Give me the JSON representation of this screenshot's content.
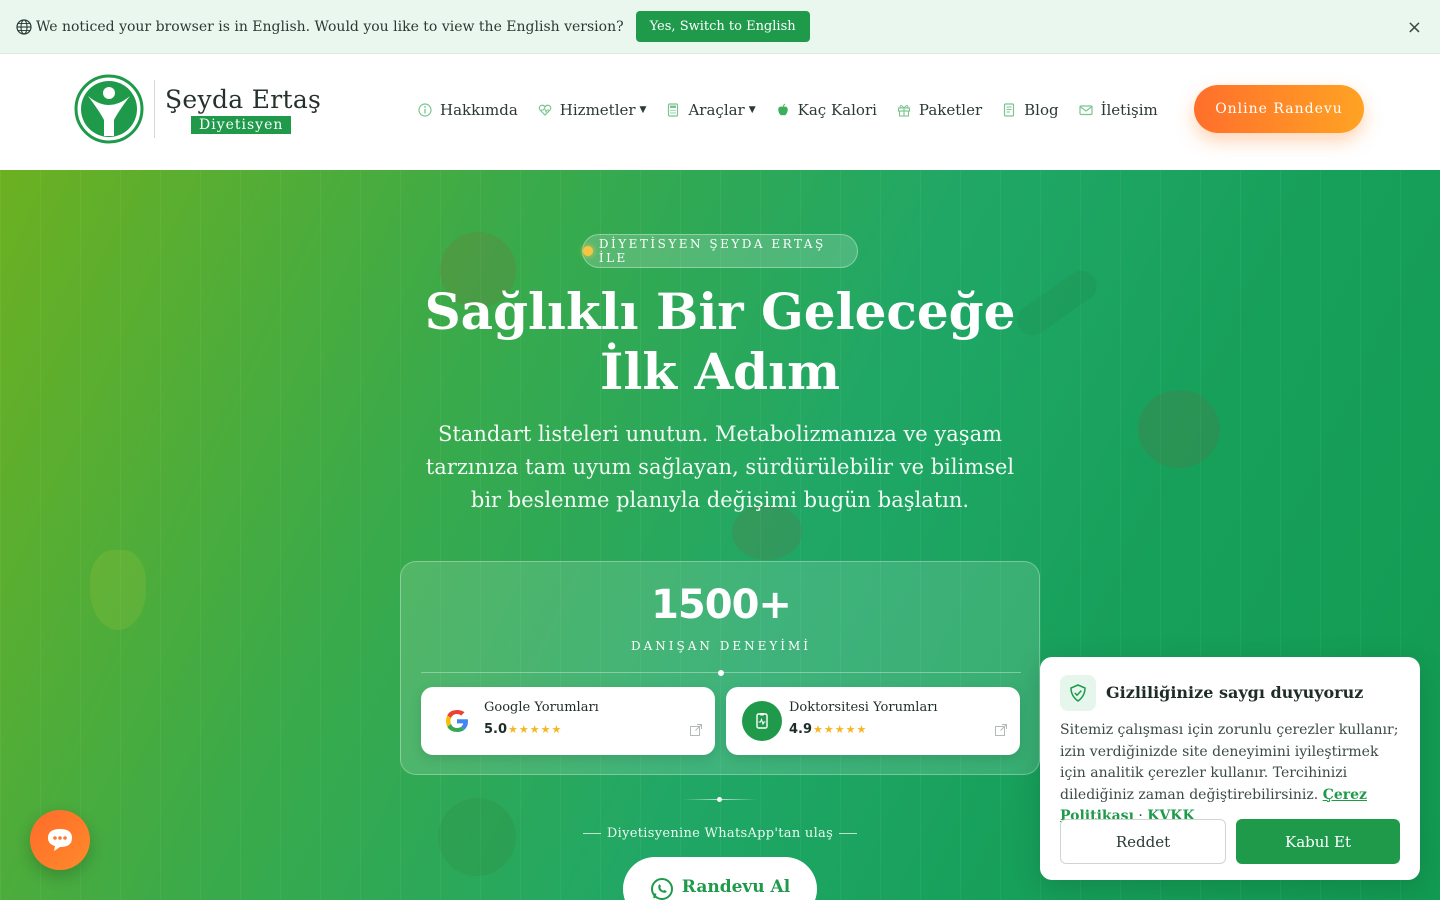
{
  "lang_bar": {
    "message": "We noticed your browser is in English. Would you like to view the English version?",
    "switch_label": "Yes, Switch to English",
    "close_label": "×",
    "icon": "globe-icon"
  },
  "header": {
    "logo_name": "Şeyda Ertaş",
    "logo_sub": "Diyetisyen",
    "nav": [
      {
        "label": "Hakkımda",
        "icon": "info-icon"
      },
      {
        "label": "Hizmetler",
        "icon": "heart-icon",
        "dropdown": true
      },
      {
        "label": "Araçlar",
        "icon": "calculator-icon",
        "dropdown": true
      },
      {
        "label": "Kaç Kalori",
        "icon": "apple-icon"
      },
      {
        "label": "Paketler",
        "icon": "gift-icon"
      },
      {
        "label": "Blog",
        "icon": "document-icon"
      },
      {
        "label": "İletişim",
        "icon": "mail-icon"
      }
    ],
    "cta_label": "Online Randevu"
  },
  "hero": {
    "badge": "DİYETİSYEN ŞEYDA ERTAŞ İLE",
    "title_line1": "Sağlıklı Bir Geleceğe",
    "title_line2": "İlk Adım",
    "subtitle": "Standart listeleri unutun. Metabolizmanıza ve yaşam tarzınıza tam uyum sağlayan, sürdürülebilir ve bilimsel bir beslenme planıyla değişimi bugün başlatın.",
    "stats_number": "1500+",
    "stats_label": "DANIŞAN DENEYİMİ",
    "reviews": [
      {
        "name": "Google Yorumları",
        "score": "5.0",
        "stars": "★★★★★",
        "icon": "google-icon"
      },
      {
        "name": "Doktorsitesi Yorumları",
        "score": "4.9",
        "stars": "★★★★★",
        "icon": "doktorsitesi-icon"
      }
    ],
    "whatsapp_text": "Diyetisyenine WhatsApp'tan ulaş",
    "appointment_label": "Randevu Al"
  },
  "cookie": {
    "title": "Gizliliğinize saygı duyuyoruz",
    "body": "Sitemiz çalışması için zorunlu çerezler kullanır; izin verdiğinizde site deneyimini iyileştirmek için analitik çerezler kullanır. Tercihinizi dilediğiniz zaman değiştirebilirsiniz.",
    "policy_link": "Çerez Politikası",
    "separator": "·",
    "kvkk_link": "KVKK",
    "reject_label": "Reddet",
    "accept_label": "Kabul Et"
  },
  "colors": {
    "brand_green": "#1f9a4b",
    "accent_orange": "#ff8a2a",
    "star": "#f5b622"
  }
}
